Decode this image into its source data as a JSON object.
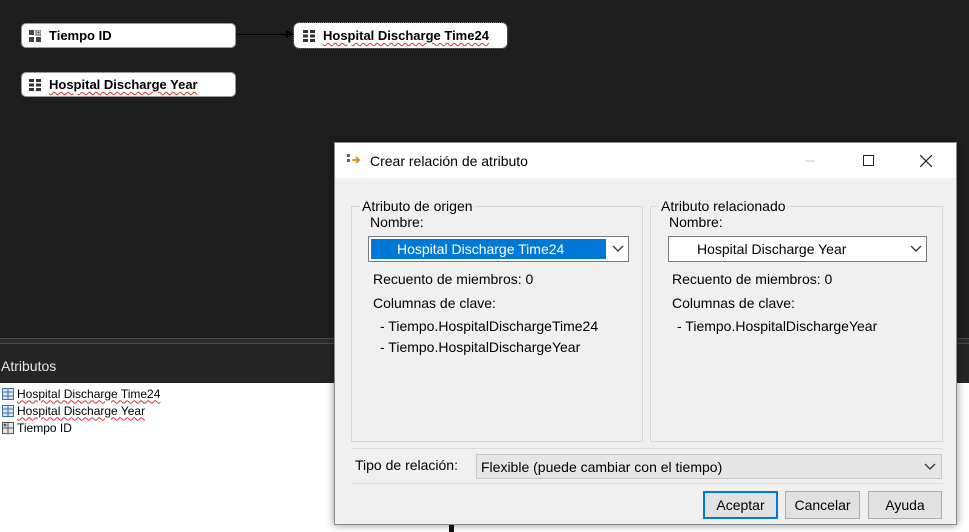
{
  "canvas": {
    "nodes": {
      "tiempo_id": {
        "label": "Tiempo ID",
        "icon": "key-attribute-icon"
      },
      "discharge_time24": {
        "label": "Hospital Discharge Time24",
        "icon": "attribute-icon"
      },
      "discharge_year": {
        "label": "Hospital Discharge Year",
        "icon": "attribute-icon"
      }
    }
  },
  "attributes_panel": {
    "title": "Atributos",
    "items": [
      {
        "label": "Hospital Discharge Time24",
        "icon": "attribute-table-icon"
      },
      {
        "label": "Hospital Discharge Year",
        "icon": "attribute-table-icon"
      },
      {
        "label": "Tiempo ID",
        "icon": "key-attribute-icon"
      }
    ]
  },
  "dialog": {
    "title": "Crear relación de atributo",
    "source": {
      "legend": "Atributo de origen",
      "name_label": "Nombre:",
      "selected": "Hospital Discharge Time24",
      "member_count": "Recuento de miembros: 0",
      "key_columns_label": "Columnas de clave:",
      "key_columns": [
        "- Tiempo.HospitalDischargeTime24",
        "- Tiempo.HospitalDischargeYear"
      ]
    },
    "related": {
      "legend": "Atributo relacionado",
      "name_label": "Nombre:",
      "selected": "Hospital Discharge Year",
      "member_count": "Recuento de miembros: 0",
      "key_columns_label": "Columnas de clave:",
      "key_columns": [
        "- Tiempo.HospitalDischargeYear"
      ]
    },
    "relation_type_label": "Tipo de relación:",
    "relation_type_value": "Flexible (puede cambiar con el tiempo)",
    "buttons": {
      "ok": "Aceptar",
      "cancel": "Cancelar",
      "help": "Ayuda"
    }
  },
  "colors": {
    "canvas_bg": "#1e1e1e",
    "accent": "#0078d7",
    "spellcheck": "#e03030"
  }
}
